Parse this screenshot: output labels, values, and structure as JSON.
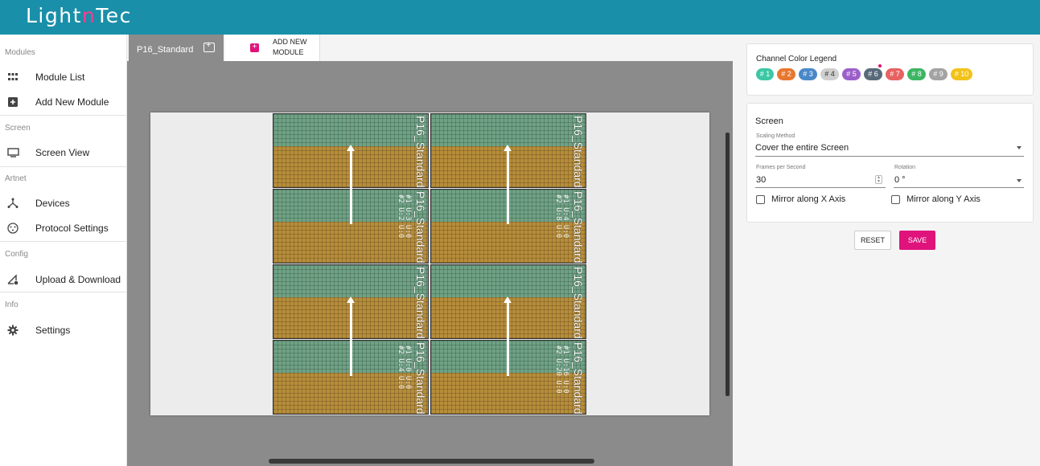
{
  "app": {
    "logo_prefix": "Light",
    "logo_accent": "n",
    "logo_suffix": "Tec"
  },
  "sidebar": {
    "sections": {
      "modules": "Modules",
      "screen": "Screen",
      "artnet": "Artnet",
      "config": "Config",
      "info": "Info"
    },
    "items": {
      "module_list": "Module List",
      "add_new_module": "Add New Module",
      "screen_view": "Screen View",
      "devices": "Devices",
      "protocol_settings": "Protocol Settings",
      "upload_download": "Upload & Download",
      "settings": "Settings"
    }
  },
  "tabs": {
    "active": "P16_Standard",
    "add_line1": "ADD NEW",
    "add_line2": "MODULE"
  },
  "modules": [
    {
      "name": "P16_Standard",
      "tag": ""
    },
    {
      "name": "P16_Standard",
      "tag": ""
    },
    {
      "name": "P16_Standard",
      "tag": "#1 U:3 U:0\n#2 U:2 U:0"
    },
    {
      "name": "P16_Standard",
      "tag": "#1 U:4 U:0\n#2 U:8 U:0"
    },
    {
      "name": "P16_Standard",
      "tag": ""
    },
    {
      "name": "P16_Standard",
      "tag": ""
    },
    {
      "name": "P16_Standard",
      "tag": "#1 U:0 U:0\n#2 U:4 U:0"
    },
    {
      "name": "P16_Standard",
      "tag": "#1 U:16 U:0\n#2 U:20 U:0"
    }
  ],
  "legend": {
    "title": "Channel Color Legend",
    "chips": [
      {
        "label": "# 1",
        "color": "#3cc7a5"
      },
      {
        "label": "# 2",
        "color": "#e8772e"
      },
      {
        "label": "# 3",
        "color": "#4a88c7"
      },
      {
        "label": "# 4",
        "color": "#cfcfcf"
      },
      {
        "label": "# 5",
        "color": "#9c5fc9"
      },
      {
        "label": "# 6",
        "color": "#586a7a"
      },
      {
        "label": "# 7",
        "color": "#e86262"
      },
      {
        "label": "# 8",
        "color": "#3cb561"
      },
      {
        "label": "# 9",
        "color": "#a3a3a3"
      },
      {
        "label": "# 10",
        "color": "#f2c21b"
      }
    ]
  },
  "screen_panel": {
    "title": "Screen",
    "scaling_label": "Scaling Method",
    "scaling_value": "Cover the entire Screen",
    "fps_label": "Frames per Second",
    "fps_value": "30",
    "rotation_label": "Rotation",
    "rotation_value": "0 °",
    "mirror_x": "Mirror along X Axis",
    "mirror_y": "Mirror along Y Axis"
  },
  "buttons": {
    "reset": "RESET",
    "save": "SAVE"
  },
  "colors": {
    "header": "#1a8fa9",
    "accent": "#e0127c"
  }
}
